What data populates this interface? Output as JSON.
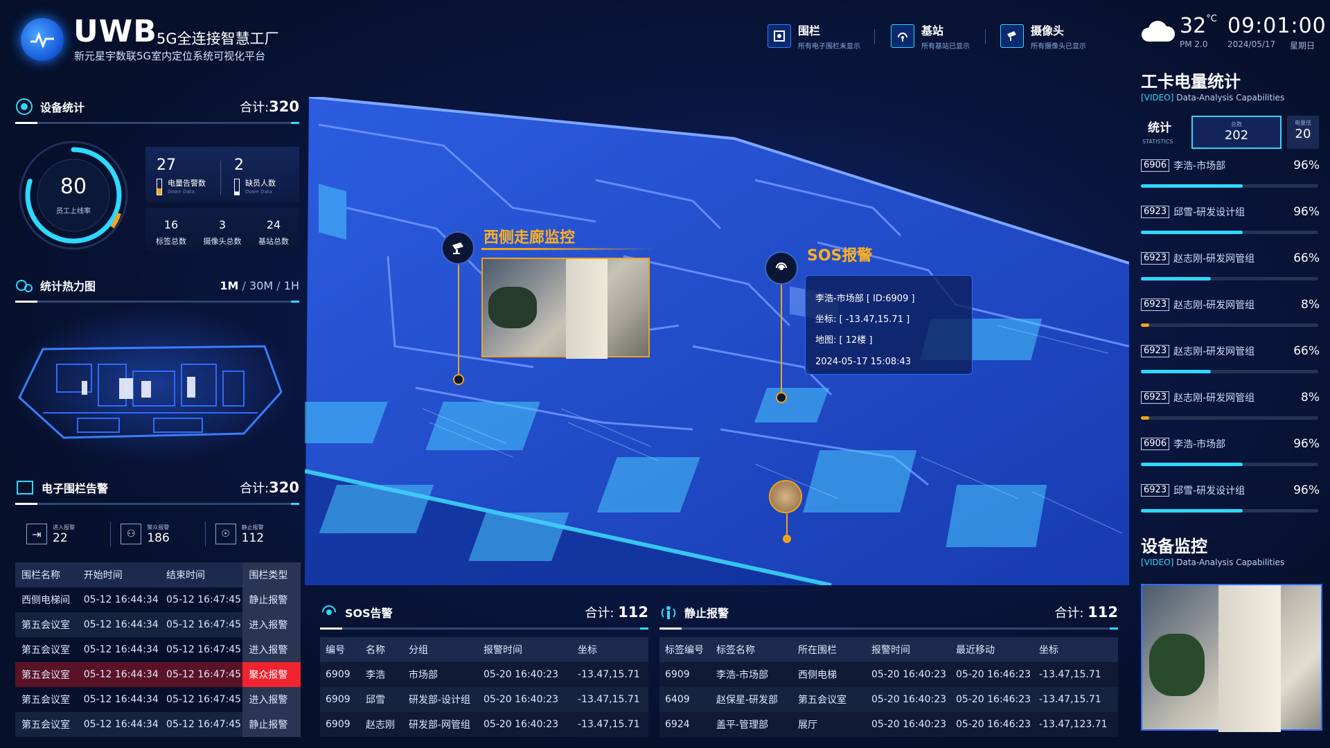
{
  "header": {
    "logo_main": "UWB",
    "logo_sub": "5G全连接智慧工厂",
    "subtitle": "新元星宇数联5G室内定位系统可视化平台",
    "buttons": [
      {
        "label": "围栏",
        "desc": "所有电子围栏未显示",
        "icon": "fence-icon"
      },
      {
        "label": "基站",
        "desc": "所有基站已显示",
        "icon": "base-station-icon"
      },
      {
        "label": "摄像头",
        "desc": "所有摄像头已显示",
        "icon": "camera-icon"
      }
    ],
    "weather": {
      "temp": "32",
      "unit": "°C",
      "pm": "PM 2.0",
      "icon": "cloud-icon"
    },
    "time": "09:01:00",
    "date": "2024/05/17",
    "weekday": "星期日"
  },
  "device_stats": {
    "title": "设备统计",
    "total_label": "合计:",
    "total": "320",
    "gauge_value": "80",
    "gauge_label": "员工上线率",
    "gauge_fraction": 0.8,
    "battery_alarm": {
      "value": "27",
      "label": "电量告警数",
      "sub": "Down Data"
    },
    "absent": {
      "value": "2",
      "label": "缺员人数",
      "sub": "Down Data"
    },
    "tags": {
      "value": "16",
      "label": "标签总数"
    },
    "cameras": {
      "value": "3",
      "label": "摄像头总数"
    },
    "stations": {
      "value": "24",
      "label": "基站总数"
    }
  },
  "heatmap": {
    "title": "统计热力图",
    "ranges": [
      "1M",
      "30M",
      "1H"
    ],
    "sep": "/"
  },
  "fence": {
    "title": "电子围栏告警",
    "total_label": "合计:",
    "total": "320",
    "stats": [
      {
        "label": "进入报警",
        "value": "22",
        "icon": "enter-alarm-icon"
      },
      {
        "label": "聚众报警",
        "value": "186",
        "icon": "crowd-alarm-icon"
      },
      {
        "label": "静止报警",
        "value": "112",
        "icon": "static-alarm-icon"
      }
    ],
    "columns": [
      "围栏名称",
      "开始时间",
      "结束时间",
      "围栏类型"
    ],
    "rows": [
      [
        "西侧电梯间",
        "05-12 16:44:34",
        "05-12 16:47:45",
        "静止报警"
      ],
      [
        "第五会议室",
        "05-12 16:44:34",
        "05-12 16:47:45",
        "进入报警"
      ],
      [
        "第五会议室",
        "05-12 16:44:34",
        "05-12 16:47:45",
        "进入报警"
      ],
      [
        "第五会议室",
        "05-12 16:44:34",
        "05-12 16:47:45",
        "聚众报警"
      ],
      [
        "第五会议室",
        "05-12 16:44:34",
        "05-12 16:47:45",
        "进入报警"
      ],
      [
        "第五会议室",
        "05-12 16:44:34",
        "05-12 16:47:45",
        "静止报警"
      ]
    ],
    "alert_row": 3
  },
  "map": {
    "camera_label": "西侧走廊监控",
    "sos_label": "SOS报警",
    "sos_info": {
      "person": "李浩-市场部 [ ID:6909 ]",
      "coord": "坐标: [ -13.47,15.71 ]",
      "map": "地图: [ 12楼 ]",
      "time": "2024-05-17 15:08:43"
    }
  },
  "sos": {
    "title": "SOS告警",
    "total_label": "合计:",
    "total": "112",
    "columns": [
      "编号",
      "名称",
      "分组",
      "报警时间",
      "坐标"
    ],
    "rows": [
      [
        "6909",
        "李浩",
        "市场部",
        "05-20 16:40:23",
        "-13.47,15.71"
      ],
      [
        "6909",
        "邱雪",
        "研发部-设计组",
        "05-20 16:40:23",
        "-13.47,15.71"
      ],
      [
        "6909",
        "赵志刚",
        "研发部-网管组",
        "05-20 16:40:23",
        "-13.47,15.71"
      ]
    ]
  },
  "static_alarm": {
    "title": "静止报警",
    "total_label": "合计:",
    "total": "112",
    "columns": [
      "标签编号",
      "标签名称",
      "所在围栏",
      "报警时间",
      "最近移动",
      "坐标"
    ],
    "rows": [
      [
        "6909",
        "李浩-市场部",
        "西侧电梯",
        "05-20 16:40:23",
        "05-20 16:46:23",
        "-13.47,15.71"
      ],
      [
        "6409",
        "赵保星-研发部",
        "第五会议室",
        "05-20 16:40:23",
        "05-20 16:46:23",
        "-13.47,15.71"
      ],
      [
        "6924",
        "盖平-管理部",
        "展厅",
        "05-20 16:40:23",
        "05-20 16:46:23",
        "-13.47,123.71"
      ]
    ]
  },
  "battery": {
    "title": "工卡电量统计",
    "tag": "[VIDEO]",
    "subtitle": "Data-Analysis Capabilities",
    "stat_label": "统计",
    "stat_sub": "STATISTICS",
    "total_label": "总数",
    "total": "202",
    "low_label": "电量低",
    "low": "20",
    "items": [
      {
        "id": "6906",
        "name": "李浩-市场部",
        "pct": "96%",
        "level": 0.96
      },
      {
        "id": "6923",
        "name": "邱雪-研发设计组",
        "pct": "96%",
        "level": 0.96
      },
      {
        "id": "6923",
        "name": "赵志刚-研发网管组",
        "pct": "66%",
        "level": 0.66
      },
      {
        "id": "6923",
        "name": "赵志刚-研发网管组",
        "pct": "8%",
        "level": 0.08
      },
      {
        "id": "6923",
        "name": "赵志刚-研发网管组",
        "pct": "66%",
        "level": 0.66
      },
      {
        "id": "6923",
        "name": "赵志刚-研发网管组",
        "pct": "8%",
        "level": 0.08
      },
      {
        "id": "6906",
        "name": "李浩-市场部",
        "pct": "96%",
        "level": 0.96
      },
      {
        "id": "6923",
        "name": "邱雪-研发设计组",
        "pct": "96%",
        "level": 0.96
      }
    ]
  },
  "monitor": {
    "title": "设备监控",
    "tag": "[VIDEO]",
    "subtitle": "Data-Analysis Capabilities"
  },
  "colors": {
    "accent": "#2fd8ff",
    "orange": "#f2a21a",
    "alert": "#f0242f",
    "panel": "#1b2a4d"
  }
}
